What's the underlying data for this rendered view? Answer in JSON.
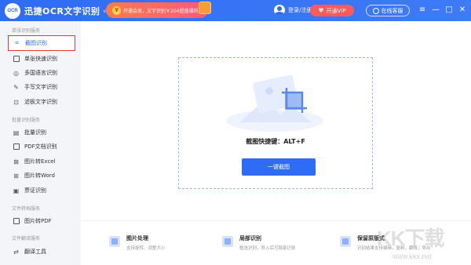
{
  "titlebar": {
    "logo_text": "OCR",
    "app_title": "迅捷OCR文字识别",
    "version": "v8.6.6.0",
    "promo_text": "开通会员，文字识别￥204超值福利",
    "login_label": "登录/注册",
    "vip_label": "开通VIP",
    "service_label": "在线客服",
    "controls": {
      "menu": "≡",
      "minimize": "—",
      "maximize": "□",
      "close": "✕"
    }
  },
  "sidebar": {
    "sections": [
      {
        "title": "单张识别服务"
      },
      {
        "title": "批量识别服务"
      },
      {
        "title": "文件转档服务"
      },
      {
        "title": "文件翻译服务"
      }
    ],
    "items": [
      {
        "label": "截图识别",
        "icon": "crop-icon"
      },
      {
        "label": "单张快速识别",
        "icon": "image-icon"
      },
      {
        "label": "多国语言识别",
        "icon": "globe-icon"
      },
      {
        "label": "手写文字识别",
        "icon": "pen-icon"
      },
      {
        "label": "滤板文字识别",
        "icon": "board-icon"
      },
      {
        "label": "批量识别",
        "icon": "stack-icon"
      },
      {
        "label": "PDF文档识别",
        "icon": "pdf-icon"
      },
      {
        "label": "图片转Excel",
        "icon": "excel-icon"
      },
      {
        "label": "图片转Word",
        "icon": "word-icon"
      },
      {
        "label": "票证识别",
        "icon": "ticket-icon"
      },
      {
        "label": "图片转PDF",
        "icon": "pdf-convert-icon"
      },
      {
        "label": "翻译工具",
        "icon": "translate-icon"
      }
    ]
  },
  "main": {
    "shortcut_text": "截图快捷键：ALT+F",
    "capture_button": "一键截图",
    "features": [
      {
        "title": "图片处理",
        "subtitle": "支持旋转、调整大小"
      },
      {
        "title": "局部识别",
        "subtitle": "框选识别，导入后可局部识别"
      },
      {
        "title": "保留原版式",
        "subtitle": "识别结果支持编辑，复制，翻译，导出"
      }
    ]
  },
  "watermark": {
    "main": "KK下载",
    "url": "www.kkx.net"
  },
  "colors": {
    "accent": "#2f6cf5",
    "active_border": "#e23a3a",
    "vip": "#ff5a5a"
  }
}
